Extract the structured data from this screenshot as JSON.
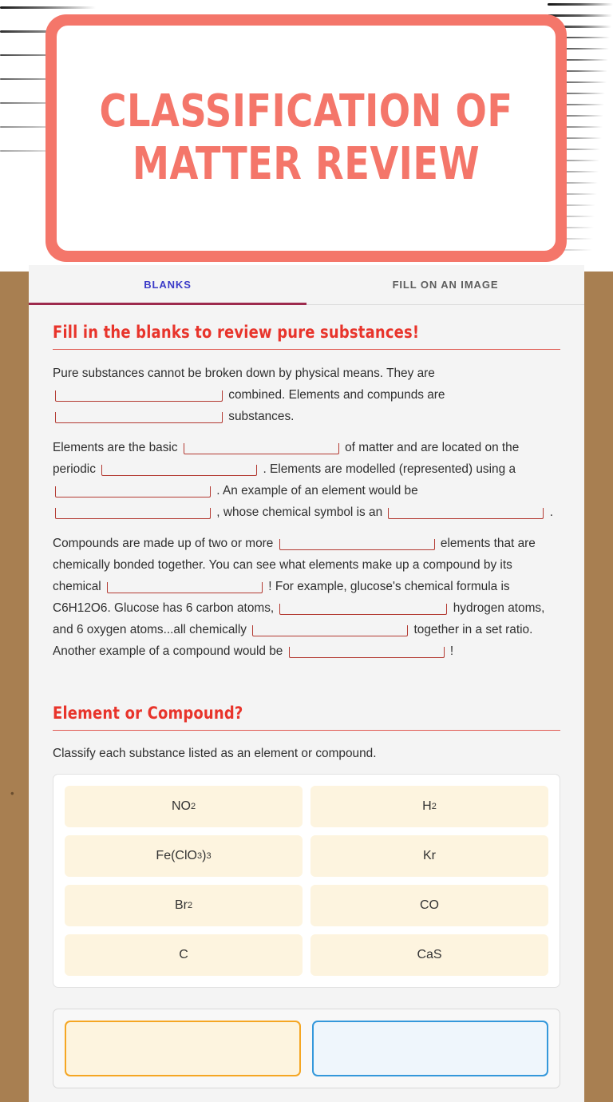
{
  "worksheet": {
    "title": "CLASSIFICATION OF MATTER REVIEW"
  },
  "tabs": [
    {
      "label": "BLANKS",
      "active": true
    },
    {
      "label": "FILL ON AN IMAGE",
      "active": false
    }
  ],
  "sections": {
    "blanks": {
      "heading": "Fill in the blanks to review pure substances!",
      "paragraph1": {
        "t1": "Pure substances cannot be broken down by physical means. They are",
        "t2": "combined. Elements and compunds are",
        "t3": "substances."
      },
      "paragraph2": {
        "t1": "Elements are the basic",
        "t2": "of matter and are located on the periodic",
        "t3": ". Elements are modelled (represented) using a",
        "t4": ". An example of an element would be",
        "t5": ", whose chemical symbol is an",
        "t6": "."
      },
      "paragraph3": {
        "t1": "Compounds are made up of two or more",
        "t2": "elements that are chemically bonded together. You can see what elements make up a compound by its chemical",
        "t3": "! For example, glucose's chemical formula is C6H12O6. Glucose has 6 carbon atoms,",
        "t4": "hydrogen atoms, and 6 oxygen atoms...all chemically",
        "t5": "together in a set ratio. Another example of a compound would be",
        "t6": "!"
      }
    },
    "classify": {
      "heading": "Element or Compound?",
      "instruction": "Classify each substance listed as an element or compound.",
      "substances": [
        {
          "formula": "NO",
          "sub": "2"
        },
        {
          "formula": "H",
          "sub": "2"
        },
        {
          "formula": "Fe(ClO",
          "sub": "3",
          "formula2": ")",
          "sub2": "3"
        },
        {
          "formula": "Kr",
          "sub": ""
        },
        {
          "formula": "Br",
          "sub": "2"
        },
        {
          "formula": "CO",
          "sub": ""
        },
        {
          "formula": "C",
          "sub": ""
        },
        {
          "formula": "CaS",
          "sub": ""
        }
      ]
    }
  },
  "colors": {
    "coral": "#f4766a",
    "heading_red": "#e8342b",
    "blank_line": "#b33a32",
    "tab_active": "#3b3bc8",
    "tab_underline": "#9d2a4d",
    "card_cream": "#fdf4df",
    "dropzone_element_border": "#f5a623",
    "dropzone_compound_border": "#3498db",
    "kraft": "#a87f51"
  }
}
